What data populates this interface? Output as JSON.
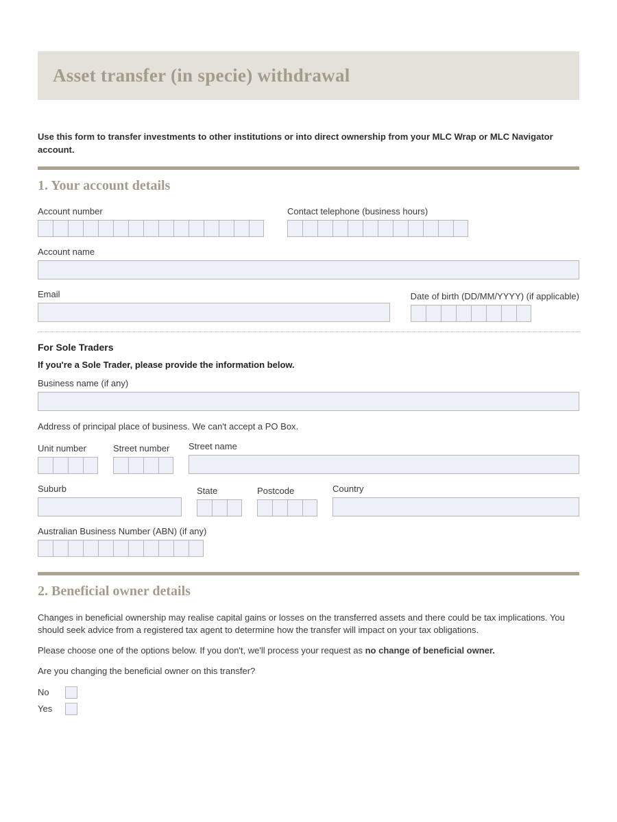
{
  "header": {
    "title": "Asset transfer (in specie) withdrawal"
  },
  "intro": "Use this form to transfer investments to other institutions or into direct ownership from your MLC Wrap or MLC Navigator account.",
  "section1": {
    "title": "1. Your account details",
    "labels": {
      "account_number": "Account number",
      "contact_phone": "Contact telephone (business hours)",
      "account_name": "Account name",
      "email": "Email",
      "dob": "Date of birth (DD/MM/YYYY) (if applicable)"
    },
    "sole_traders": {
      "heading": "For Sole Traders",
      "instruction": "If you're a Sole Trader, please provide the information below.",
      "business_name": "Business name (if any)",
      "address_note": "Address of principal place of business. We can't accept a PO Box.",
      "unit_number": "Unit number",
      "street_number": "Street number",
      "street_name": "Street name",
      "suburb": "Suburb",
      "state": "State",
      "postcode": "Postcode",
      "country": "Country",
      "abn": "Australian Business Number (ABN) (if any)"
    }
  },
  "section2": {
    "title": "2. Beneficial owner details",
    "para1": "Changes in beneficial ownership may realise capital gains or losses on the transferred assets and there could be tax implications. You should seek advice from a registered tax agent to determine how the transfer will impact on your tax obligations.",
    "para2_a": "Please choose one of the options below. If you don't, we'll process your request as ",
    "para2_b": "no change of beneficial owner.",
    "question": "Are you changing the beneficial owner on this transfer?",
    "no": "No",
    "yes": "Yes"
  }
}
